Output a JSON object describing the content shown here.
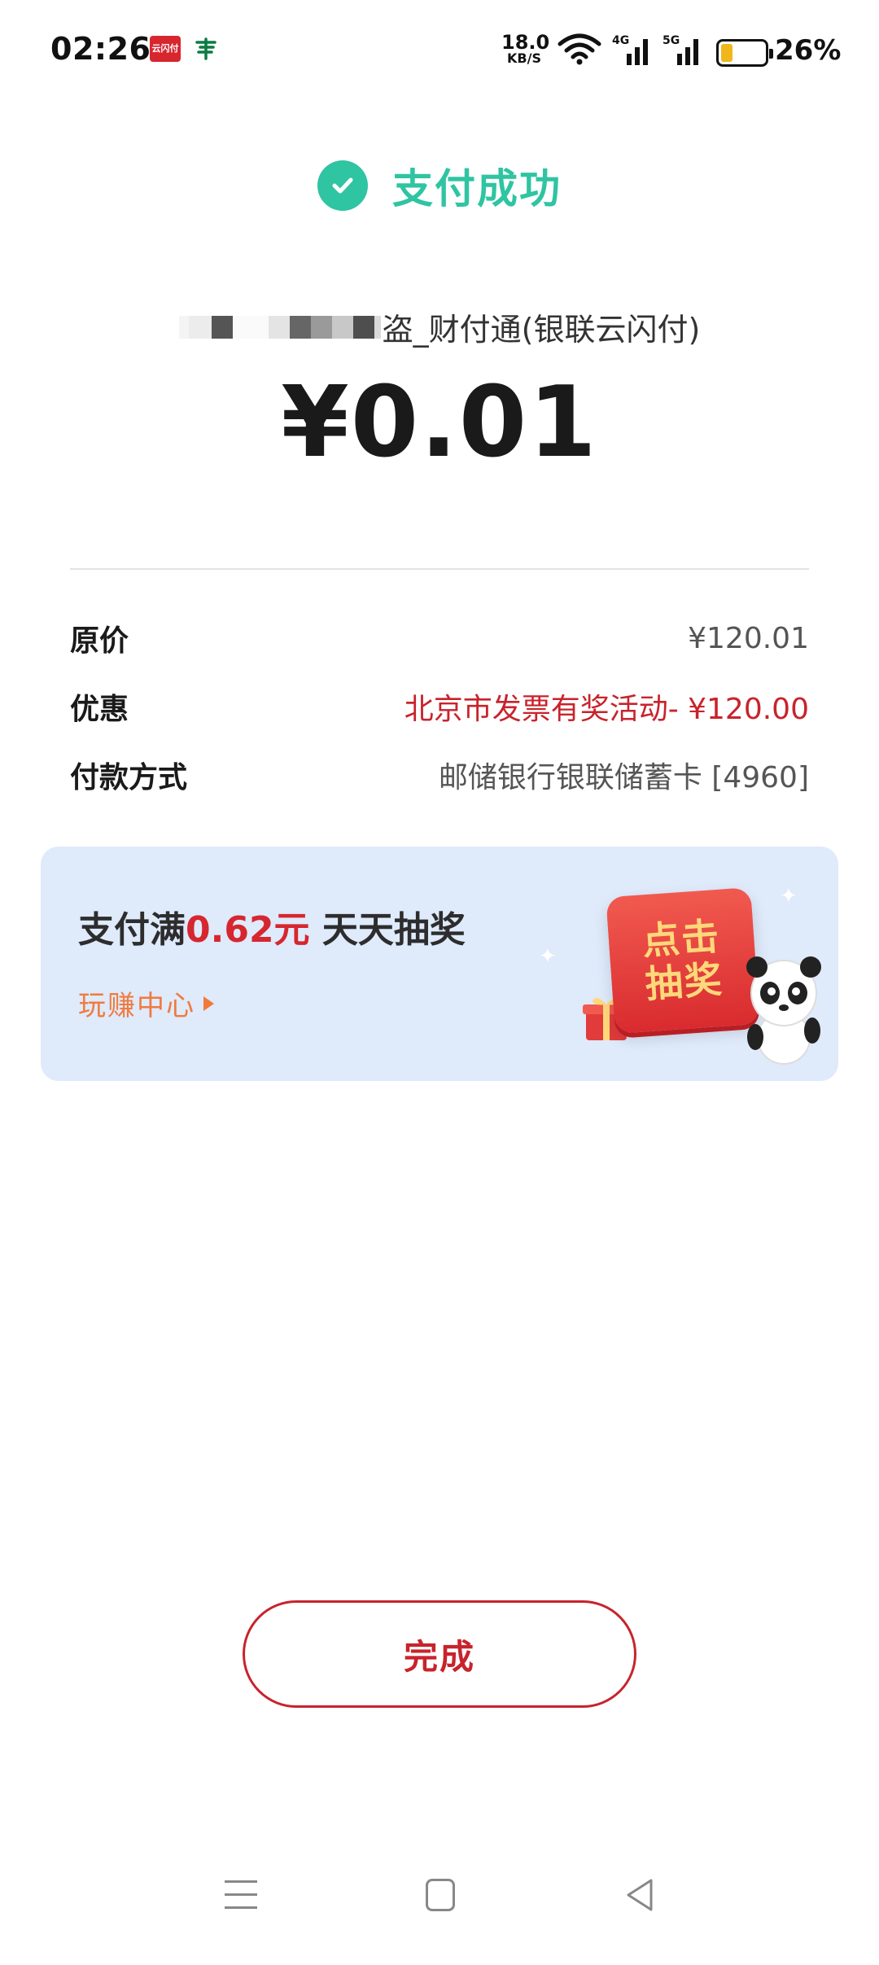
{
  "status_bar": {
    "time": "02:26",
    "notif_app1_label": "云闪付",
    "notif_app2_icon": "postal-logo-icon",
    "net_speed_value": "18.0",
    "net_speed_unit": "KB/S",
    "signal1_label": "4G",
    "signal2_label": "5G",
    "battery_percent": "26%",
    "battery_level": 0.26,
    "battery_color": "#f0b71c"
  },
  "header": {
    "title": "支付成功",
    "accent": "#2fc4a2"
  },
  "payment": {
    "merchant_suffix": "盗_财付通(银联云闪付)",
    "amount": "¥0.01"
  },
  "details": [
    {
      "label": "原价",
      "value": "¥120.01",
      "highlight": false
    },
    {
      "label": "优惠",
      "value": "北京市发票有奖活动- ¥120.00",
      "highlight": true
    },
    {
      "label": "付款方式",
      "value": "邮储银行银联储蓄卡 [4960]",
      "highlight": false
    }
  ],
  "promo": {
    "title_prefix": "支付满",
    "title_amount": "0.62元",
    "title_suffix": " 天天抽奖",
    "link": "玩赚中心",
    "button_line1": "点击",
    "button_line2": "抽奖",
    "background": "#dfeafb",
    "highlight_color": "#d6262f"
  },
  "footer": {
    "done_label": "完成",
    "accent": "#c8232c"
  }
}
